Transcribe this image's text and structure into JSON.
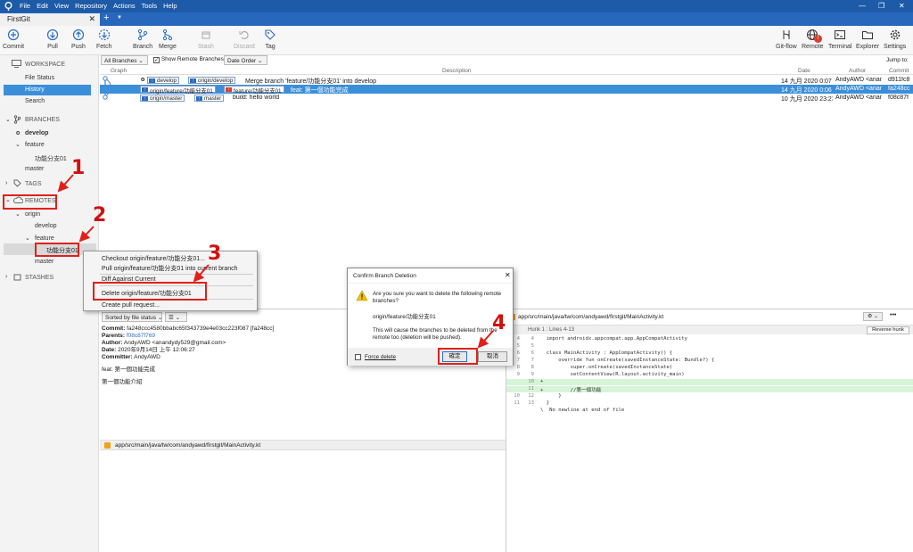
{
  "menu": [
    "File",
    "Edit",
    "View",
    "Repository",
    "Actions",
    "Tools",
    "Help"
  ],
  "repo_tab": "FirstGit",
  "new_tab_glyph": "+",
  "toolbar": {
    "commit": "Commit",
    "pull": "Pull",
    "push": "Push",
    "fetch": "Fetch",
    "branch": "Branch",
    "merge": "Merge",
    "stash": "Stash",
    "discard": "Discard",
    "tag": "Tag",
    "gitflow": "Git-flow",
    "remote": "Remote",
    "terminal": "Terminal",
    "explorer": "Explorer",
    "settings": "Settings",
    "remote_badge": "!"
  },
  "sidebar": {
    "workspace": "WORKSPACE",
    "file_status": "File Status",
    "history": "History",
    "search": "Search",
    "branches": "BRANCHES",
    "develop": "develop",
    "feature": "feature",
    "feature_branch": "功能分支01",
    "master": "master",
    "tags": "TAGS",
    "remotes": "REMOTES",
    "origin": "origin",
    "remote_develop": "develop",
    "remote_feature": "feature",
    "remote_feature_branch": "功能分支01",
    "remote_master": "master",
    "stashes": "STASHES"
  },
  "filterbar": {
    "all_branches": "All Branches",
    "show_remote": "Show Remote Branches",
    "date_order": "Date Order",
    "jump_to": "Jump to:"
  },
  "columns": {
    "graph": "Graph",
    "description": "Description",
    "date": "Date",
    "author": "Author",
    "commit": "Commit"
  },
  "commits": [
    {
      "tags": [
        "develop",
        "origin/develop"
      ],
      "message": "Merge branch 'feature/功能分支01' into develop",
      "date": "14 九月 2020 0:07",
      "author": "AndyAWD <anan",
      "hash": "d911fc8"
    },
    {
      "tags": [
        "origin/feature/功能分支01",
        "feature/功能分支01"
      ],
      "message": "feat: 第一個功能完成",
      "date": "14 九月 2020 0:06",
      "author": "AndyAWD <anan",
      "hash": "fa248cc"
    },
    {
      "tags": [
        "origin/master",
        "master"
      ],
      "message": "build: hello world",
      "date": "10 九月 2020 23:23",
      "author": "AndyAWD <anan",
      "hash": "f08c87f"
    }
  ],
  "context_menu": {
    "checkout": "Checkout origin/feature/功能分支01...",
    "pull": "Pull origin/feature/功能分支01 into current branch",
    "diff": "Diff Against Current",
    "delete": "Delete origin/feature/功能分支01",
    "pull_request": "Create pull request..."
  },
  "details": {
    "sort": "Sorted by file status",
    "list_mode": "☰",
    "commit_label": "Commit:",
    "commit_value": "fa248ccc4580bbabc65f343739e4e03cc223f087 [fa248cc]",
    "parents_label": "Parents:",
    "parents_value": "f08c87f769",
    "author_label": "Author:",
    "author_value": "AndyAWD <anandydy529@gmail.com>",
    "date_label": "Date:",
    "date_value": "2020年9月14日 上午 12:06:27",
    "committer_label": "Committer:",
    "committer_value": "AndyAWD",
    "msg1": "feat: 第一個功能完成",
    "msg2": "第一個功能介紹",
    "file": "app/src/main/java/tw/com/andyawd/firstgit/MainActivity.kt"
  },
  "diff": {
    "file": "app/src/main/java/tw/com/andyawd/firstgit/MainActivity.kt",
    "hunk": "Hunk 1 : Lines 4-13",
    "reverse": "Reverse hunk",
    "more": "•••",
    "lines": [
      {
        "a": "4",
        "b": "4",
        "code": "  import androidx.appcompat.app.AppCompatActivity",
        "type": "ctx"
      },
      {
        "a": "5",
        "b": "5",
        "code": "",
        "type": "ctx"
      },
      {
        "a": "6",
        "b": "6",
        "code": "  class MainActivity : AppCompatActivity() {",
        "type": "ctx"
      },
      {
        "a": "7",
        "b": "7",
        "code": "      override fun onCreate(savedInstanceState: Bundle?) {",
        "type": "ctx"
      },
      {
        "a": "8",
        "b": "8",
        "code": "          super.onCreate(savedInstanceState)",
        "type": "ctx"
      },
      {
        "a": "9",
        "b": "9",
        "code": "          setContentView(R.layout.activity_main)",
        "type": "ctx"
      },
      {
        "a": "",
        "b": "10",
        "code": "+",
        "type": "add"
      },
      {
        "a": "",
        "b": "11",
        "code": "+         //第一個功能",
        "type": "add"
      },
      {
        "a": "10",
        "b": "12",
        "code": "      }",
        "type": "ctx"
      },
      {
        "a": "11",
        "b": "13",
        "code": "  }",
        "type": "ctx"
      },
      {
        "a": "",
        "b": "",
        "code": "\\  No newline at end of file",
        "type": "ctx"
      }
    ]
  },
  "dialog": {
    "title": "Confirm Branch Deletion",
    "question": "Are you sure you want to delete the following remote branches?",
    "branch": "origin/feature/功能分支01",
    "note": "This will cause the branches to be deleted from the remote too (deletion will be pushed).",
    "force": "Force delete",
    "ok": "確定",
    "cancel": "取消",
    "close": "✕"
  },
  "annotations": [
    "1",
    "2",
    "3",
    "4"
  ],
  "colors": {
    "accent": "#3b8fd9",
    "title_bar": "#1d5aa8",
    "annotation": "#e0201a"
  }
}
